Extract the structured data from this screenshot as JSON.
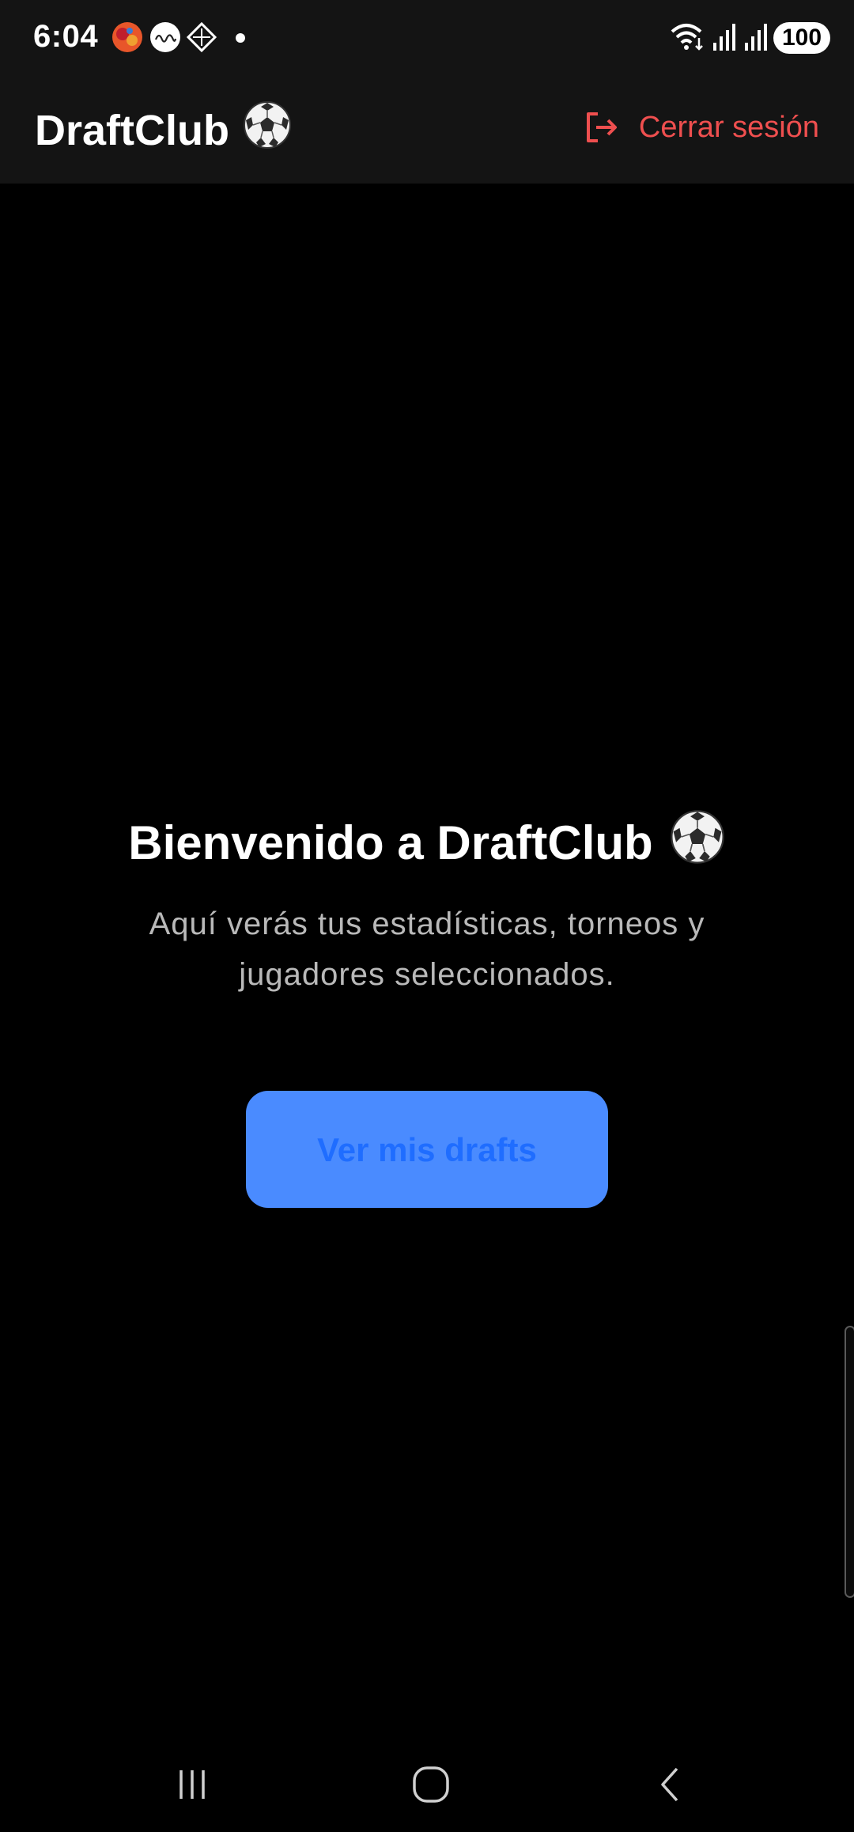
{
  "status_bar": {
    "time": "6:04",
    "battery": "100",
    "notification_icons": [
      "game-app-icon",
      "telugu-app-icon",
      "grid-app-icon"
    ],
    "system_icons": [
      "wifi-icon",
      "signal-icon",
      "signal-icon"
    ]
  },
  "app_bar": {
    "title": "DraftClub",
    "title_icon": "soccer-ball-icon",
    "logout_label": "Cerrar sesión",
    "logout_icon": "logout-icon",
    "logout_color": "#ef4f4f"
  },
  "main": {
    "welcome_title": "Bienvenido a DraftClub",
    "welcome_icon": "soccer-ball-icon",
    "subtitle": "Aquí verás tus estadísticas, torneos y jugadores seleccionados.",
    "primary_button_label": "Ver mis drafts",
    "primary_button_color": "#4a8bff"
  },
  "nav_bar": {
    "buttons": [
      "recent-apps-icon",
      "home-icon",
      "back-icon"
    ]
  }
}
